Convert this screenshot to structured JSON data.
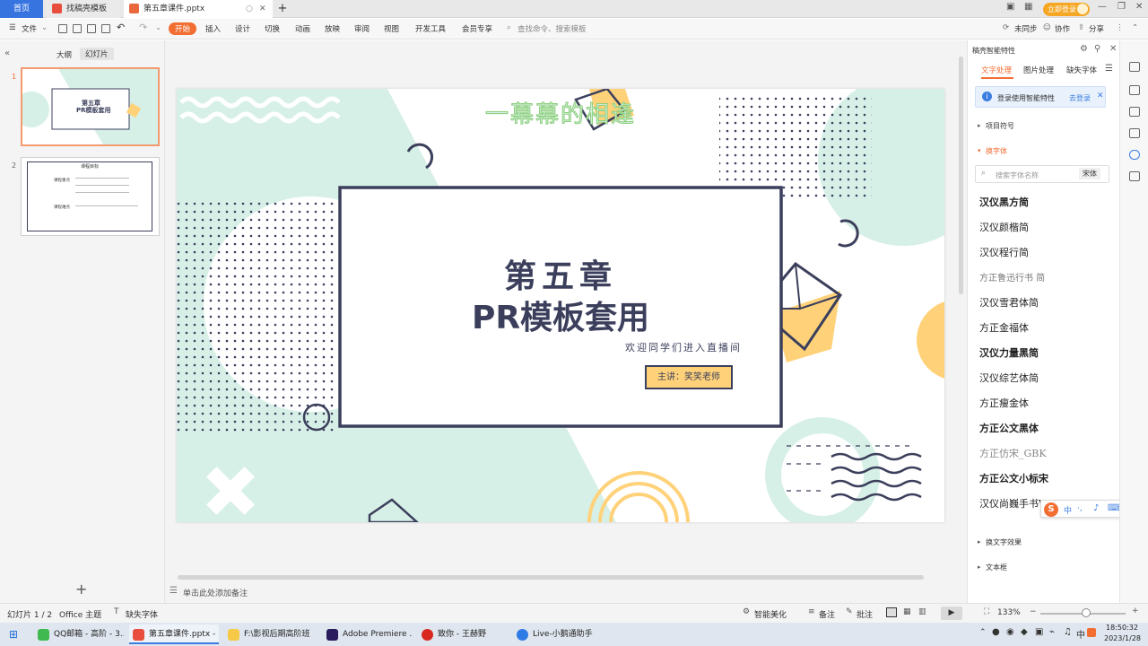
{
  "tabs": {
    "home": "首页",
    "template": "找稿壳模板",
    "document": "第五章课件.pptx",
    "login": "立即登录"
  },
  "menu": {
    "file": "文件",
    "items": [
      "开始",
      "插入",
      "设计",
      "切换",
      "动画",
      "放映",
      "审阅",
      "视图",
      "开发工具",
      "会员专享"
    ],
    "search": "查找命令、搜索模板",
    "sync": "未同步",
    "collab": "协作",
    "share": "分享"
  },
  "left_panel": {
    "outline": "大纲",
    "slides": "幻灯片",
    "n1": "1",
    "n2": "2",
    "thumb1_title": "第五章",
    "thumb1_sub": "PR模板套用",
    "thumb2_title": "课程目标",
    "thumb2_l1": "课程重点",
    "thumb2_l2": "课程难点"
  },
  "slide": {
    "top_text": "一幕幕的相逢",
    "title1": "第五章",
    "title2": "PR模板套用",
    "subtitle": "欢迎同学们进入直播间",
    "lecturer": "主讲：笑笑老师"
  },
  "notes_placeholder": "单击此处添加备注",
  "right_panel": {
    "title": "稿壳智能特性",
    "tabs": [
      "文字处理",
      "图片处理",
      "缺失字体"
    ],
    "login_prompt": "登录使用智能特性",
    "login_link": "去登录",
    "bullets": "项目符号",
    "change_font": "换字体",
    "font_search": "搜索字体名称",
    "font_current": "宋体",
    "fonts": [
      "汉仪黑方简",
      "汉仪颜楷简",
      "汉仪程行简",
      "方正鲁迅行书 简",
      "汉仪雪君体简",
      "方正金福体",
      "汉仪力量黑简",
      "汉仪综艺体简",
      "方正瘦金体",
      "方正公文黑体",
      "方正仿宋_GBK",
      "方正公文小标宋",
      "汉仪尚巍手书W"
    ],
    "text_effect": "换文字效果",
    "textbox": "文本框"
  },
  "status": {
    "slide_count": "幻灯片 1 / 2",
    "theme": "Office 主题",
    "missing_font": "缺失字体",
    "beautify": "智能美化",
    "notes": "备注",
    "comments": "批注",
    "zoom": "133%"
  },
  "taskbar": {
    "apps": [
      "QQ邮箱 - 高阶 - 3...",
      "第五章课件.pptx - ...",
      "F:\\影视后期高阶班",
      "Adobe Premiere ...",
      "致你 - 王赫野",
      "Live-小鹅通助手"
    ],
    "time": "18:50:32",
    "date": "2023/1/28"
  },
  "ime": {
    "lang": "中"
  },
  "colors": {
    "accent": "#f26e33",
    "slide_frame": "#3b3f5c",
    "mint": "#d7f0e7",
    "orange": "#ffd27a"
  }
}
